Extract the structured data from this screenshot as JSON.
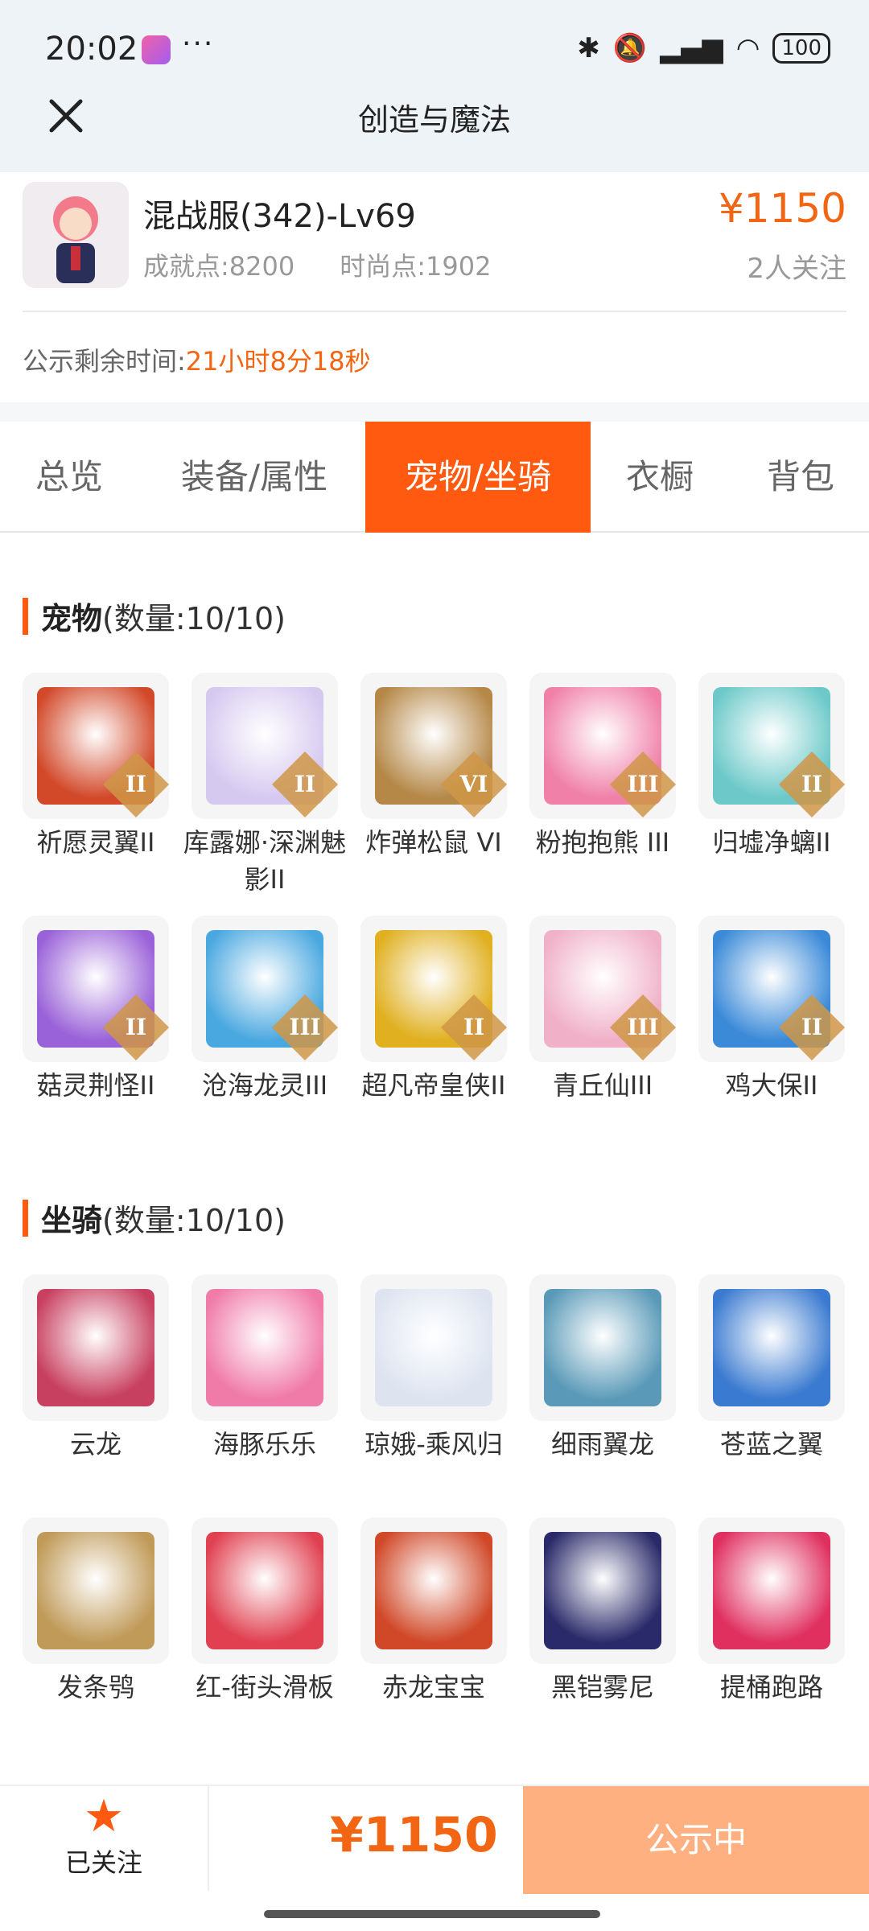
{
  "status_bar": {
    "time": "20:02",
    "dots": "···",
    "battery": "100"
  },
  "header": {
    "title": "创造与魔法"
  },
  "role": {
    "name": "混战服(342)-Lv69",
    "achievement": "成就点:8200",
    "fashion": "时尚点:1902",
    "price": "¥1150",
    "follow_count": "2人关注",
    "countdown_label": "公示剩余时间:",
    "countdown_value": "21小时8分18秒"
  },
  "tabs": [
    {
      "label": "总览"
    },
    {
      "label": "装备/属性"
    },
    {
      "label": "宠物/坐骑",
      "active": true
    },
    {
      "label": "衣橱"
    },
    {
      "label": "背包"
    }
  ],
  "pets": {
    "title": "宠物",
    "count": "(数量:10/10)",
    "items": [
      {
        "label": "祈愿灵翼II",
        "rank": "II",
        "color": "#d2492a"
      },
      {
        "label": "库露娜·深渊魅影II",
        "rank": "II",
        "color": "#d6c9f0"
      },
      {
        "label": "炸弹松鼠 VI",
        "rank": "VI",
        "color": "#b58848"
      },
      {
        "label": "粉抱抱熊 III",
        "rank": "III",
        "color": "#f080a8"
      },
      {
        "label": "归墟净螭II",
        "rank": "II",
        "color": "#6dc9c9"
      },
      {
        "label": "菇灵荆怪II",
        "rank": "II",
        "color": "#9a62d8"
      },
      {
        "label": "沧海龙灵III",
        "rank": "III",
        "color": "#4aa8e0"
      },
      {
        "label": "超凡帝皇侠II",
        "rank": "II",
        "color": "#e0b020"
      },
      {
        "label": "青丘仙III",
        "rank": "III",
        "color": "#f0b0c8"
      },
      {
        "label": "鸡大保II",
        "rank": "II",
        "color": "#3a8ad8"
      }
    ]
  },
  "mounts": {
    "title": "坐骑",
    "count": "(数量:10/10)",
    "items": [
      {
        "label": "云龙",
        "color": "#c84060"
      },
      {
        "label": "海豚乐乐",
        "color": "#f07aa8"
      },
      {
        "label": "琼娥-乘风归",
        "color": "#dde4f0"
      },
      {
        "label": "细雨翼龙",
        "color": "#5a9ab8"
      },
      {
        "label": "苍蓝之翼",
        "color": "#3a7ad0"
      },
      {
        "label": "发条鸮",
        "color": "#c09a58"
      },
      {
        "label": "红-街头滑板",
        "color": "#e04050"
      },
      {
        "label": "赤龙宝宝",
        "color": "#d04828"
      },
      {
        "label": "黑铠雾尼",
        "color": "#2a2a6a"
      },
      {
        "label": "提桶跑路",
        "color": "#e03060"
      }
    ]
  },
  "bottom": {
    "follow_label": "已关注",
    "price": "¥1150",
    "status_label": "公示中"
  },
  "colors": {
    "accent": "#ff5a0f",
    "price": "#f26512",
    "status_button": "#ffb080"
  }
}
